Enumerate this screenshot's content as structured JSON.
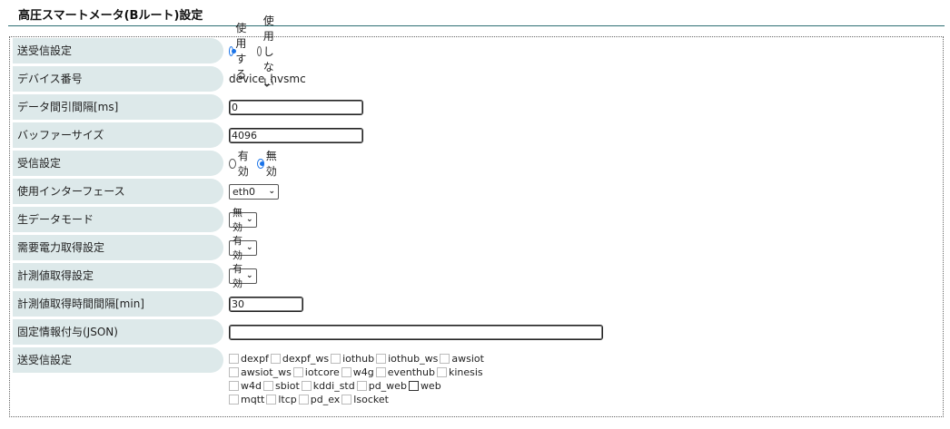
{
  "page": {
    "title": "高圧スマートメータ(Bルート)設定"
  },
  "form": {
    "send_receive": {
      "label": "送受信設定",
      "options": [
        "使用する",
        "使用しない"
      ],
      "selected": "使用する"
    },
    "device_number": {
      "label": "デバイス番号",
      "value": "device_hvsmc"
    },
    "data_interval": {
      "label": "データ間引間隔[ms]",
      "value": "0"
    },
    "buffer_size": {
      "label": "バッファーサイズ",
      "value": "4096"
    },
    "receive_setting": {
      "label": "受信設定",
      "options": [
        "有効",
        "無効"
      ],
      "selected": "無効"
    },
    "interface": {
      "label": "使用インターフェース",
      "value": "eth0"
    },
    "raw_data_mode": {
      "label": "生データモード",
      "value": "無効"
    },
    "demand_power": {
      "label": "需要電力取得設定",
      "value": "有効"
    },
    "measurement": {
      "label": "計測値取得設定",
      "value": "有効"
    },
    "measurement_interval": {
      "label": "計測値取得時間間隔[min]",
      "value": "30"
    },
    "fixed_info": {
      "label": "固定情報付与(JSON)",
      "value": ""
    },
    "send_targets": {
      "label": "送受信設定",
      "lines": [
        [
          "dexpf",
          "dexpf_ws",
          "iothub",
          "iothub_ws",
          "awsiot"
        ],
        [
          "awsiot_ws",
          "iotcore",
          "w4g",
          "eventhub",
          "kinesis"
        ],
        [
          "w4d",
          "sbiot",
          "kddi_std",
          "pd_web",
          "web"
        ],
        [
          "mqtt",
          "ltcp",
          "pd_ex",
          "lsocket"
        ]
      ]
    }
  }
}
